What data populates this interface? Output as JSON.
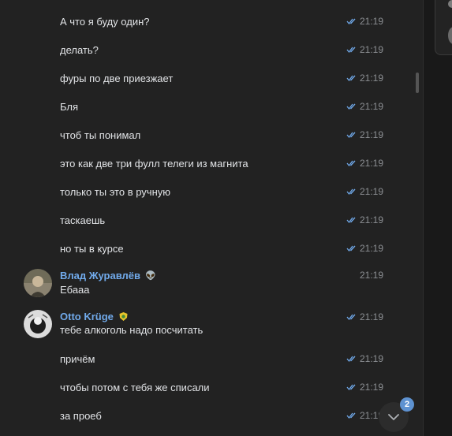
{
  "messages_top": [
    {
      "text": "А что я буду один?",
      "time": "21:19"
    },
    {
      "text": "делать?",
      "time": "21:19"
    },
    {
      "text": "фуры по две приезжает",
      "time": "21:19"
    },
    {
      "text": "Бля",
      "time": "21:19"
    },
    {
      "text": "чтоб ты понимал",
      "time": "21:19"
    },
    {
      "text": "это как две три фулл телеги из магнита",
      "time": "21:19"
    },
    {
      "text": "только ты это в ручную",
      "time": "21:19"
    },
    {
      "text": "таскаешь",
      "time": "21:19"
    },
    {
      "text": "но ты в курсе",
      "time": "21:19"
    }
  ],
  "vlad": {
    "name": "Влад Журавлёв",
    "emoji": "👽",
    "text": "Ебааа",
    "time": "21:19"
  },
  "otto": {
    "name": "Otto Krüge",
    "text": "тебе алкоголь надо посчитать",
    "time": "21:19"
  },
  "messages_bottom": [
    {
      "text": "причём",
      "time": "21:19"
    },
    {
      "text": "чтобы потом с тебя же списали",
      "time": "21:19"
    },
    {
      "text": "за проеб",
      "time": "21:19"
    }
  ],
  "scroll_badge": "2",
  "colors": {
    "accent": "#71aaeb",
    "ticks": "#71aaeb",
    "badge": "#5e92d1"
  }
}
